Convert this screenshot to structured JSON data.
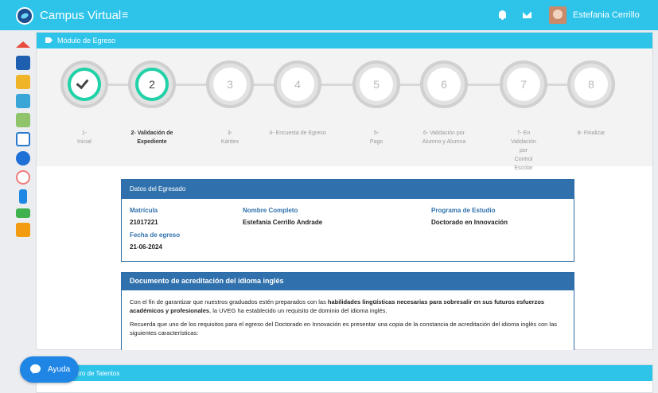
{
  "app": {
    "title": "Campus Virtual",
    "menu_icon": "≡",
    "user_name": "Estefania Cerrillo"
  },
  "sidebar": {
    "icons": [
      "home-icon",
      "book-icon",
      "classroom-icon",
      "help-icon",
      "calendar-icon",
      "board-icon",
      "globe-icon",
      "badge-icon",
      "phone-icon",
      "gamepad-icon",
      "gift-icon"
    ]
  },
  "module": {
    "title": "Módulo de Egreso"
  },
  "steps": [
    {
      "num": "",
      "label": "1-\nInicial",
      "state": "done"
    },
    {
      "num": "2",
      "label": "2- Validación de\nExpediente",
      "state": "active"
    },
    {
      "num": "3",
      "label": "3-\nKárdex",
      "state": "pending"
    },
    {
      "num": "4",
      "label": "4- Encuesta de Egreso",
      "state": "pending"
    },
    {
      "num": "5",
      "label": "5-\nPago",
      "state": "pending"
    },
    {
      "num": "6",
      "label": "6- Validación por\nAlumno y Alumna",
      "state": "pending"
    },
    {
      "num": "7",
      "label": "7- En\nValidación\npor\nControl\nEscolar",
      "state": "pending"
    },
    {
      "num": "8",
      "label": "8- Finalizar",
      "state": "pending"
    }
  ],
  "graduate": {
    "title": "Datos del Egresado",
    "matricula_label": "Matrícula",
    "matricula": "21017221",
    "nombre_label": "Nombre Completo",
    "nombre": "Estefania Cerrillo Andrade",
    "programa_label": "Programa de Estudio",
    "programa": "Doctorado en Innovación",
    "fecha_label": "Fecha de egreso",
    "fecha": "21-06-2024"
  },
  "document": {
    "title": "Documento de acreditación del idioma inglés",
    "p1_a": "Con el fin de garantizar que nuestros graduados estén preparados con las ",
    "p1_b": "habilidades lingüísticas necesarias para sobresalir en sus futuros esfuerzos académicos y profesionales",
    "p1_c": ", la UVEG ha establecido un requisito de dominio del idioma inglés.",
    "p2": "Recuerda que uno de los requisitos para el egreso del Doctorado en Innovación es presentar una copia de la constancia de acreditación del idioma inglés con las siguientes características:"
  },
  "panel2": {
    "title": "tro de Talentos"
  },
  "help": {
    "label": "Ayuda"
  },
  "colors": {
    "accent": "#2ec4ea",
    "card_header": "#3071ad",
    "step_done": "#21d1a8"
  }
}
